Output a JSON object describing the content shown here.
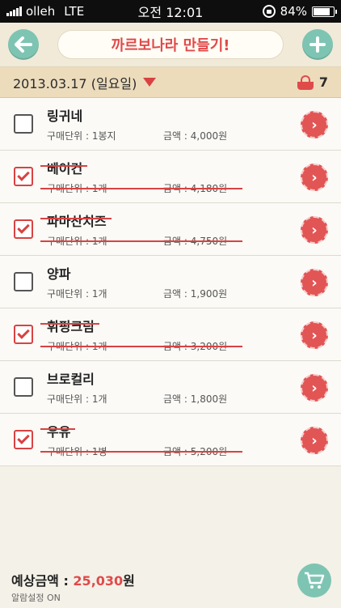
{
  "status": {
    "carrier": "olleh",
    "network": "LTE",
    "time": "오전 12:01",
    "battery": "84%",
    "battery_level": 0.84
  },
  "header": {
    "title": "까르보나라 만들기!",
    "back_icon": "back-arrow-icon",
    "add_icon": "plus-icon"
  },
  "datebar": {
    "date": "2013.03.17 (일요일)",
    "count": "7"
  },
  "items": [
    {
      "name": "링귀네",
      "unit": "구매단위 : 1봉지",
      "price": "금액 : 4,000원",
      "checked": false
    },
    {
      "name": "베이컨",
      "unit": "구매단위 : 1개",
      "price": "금액 : 4,180원",
      "checked": true
    },
    {
      "name": "파마산치즈",
      "unit": "구매단위 : 1개",
      "price": "금액 : 4,750원",
      "checked": true
    },
    {
      "name": "양파",
      "unit": "구매단위 : 1개",
      "price": "금액 : 1,900원",
      "checked": false
    },
    {
      "name": "휘핑크림",
      "unit": "구매단위 : 1개",
      "price": "금액 : 3,200원",
      "checked": true
    },
    {
      "name": "브로컬리",
      "unit": "구매단위 : 1개",
      "price": "금액 : 1,800원",
      "checked": false
    },
    {
      "name": "우유",
      "unit": "구매단위 : 1병",
      "price": "금액 : 5,200원",
      "checked": true
    }
  ],
  "footer": {
    "total_label": "예상금액 : ",
    "total_amount": "25,030",
    "total_unit": "원",
    "alarm": "알람설정 ON"
  },
  "colors": {
    "accent_red": "#e04a4a",
    "accent_teal": "#7ec4b3",
    "header_bg": "#f1ead8",
    "datebar_bg": "#ecdcbc"
  }
}
